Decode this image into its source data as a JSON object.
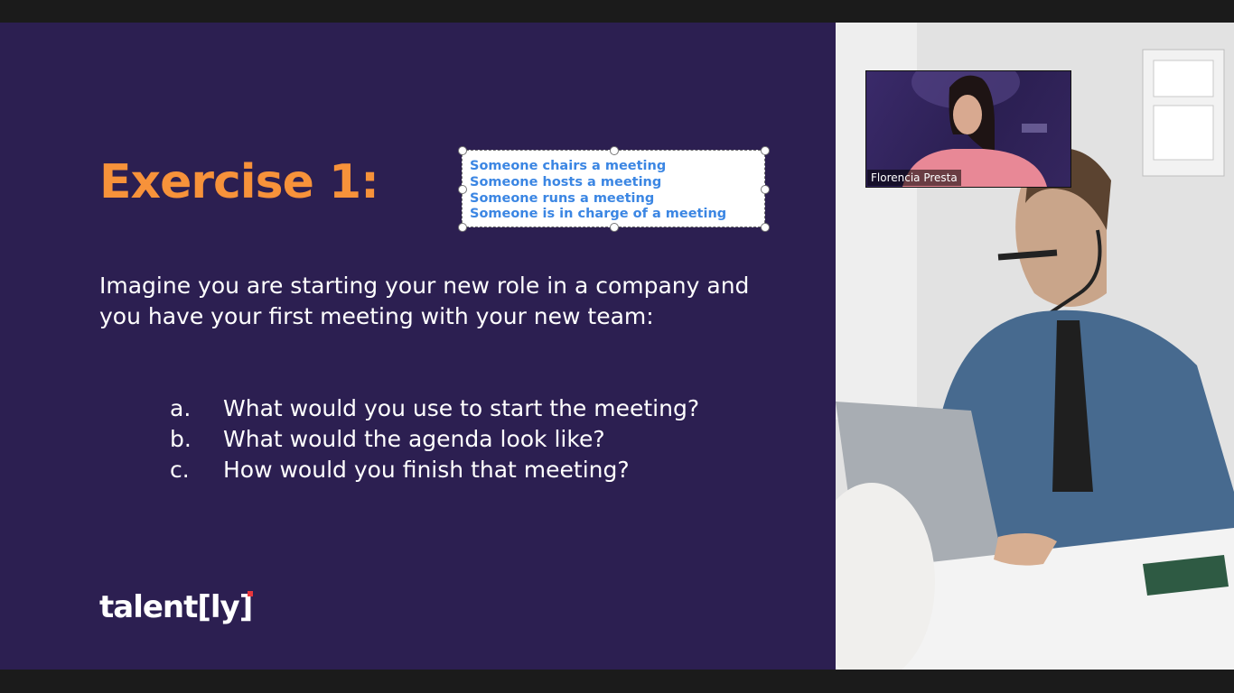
{
  "slide": {
    "title": "Exercise 1:",
    "textbox_lines": [
      "Someone chairs a meeting",
      "Someone hosts a meeting",
      "Someone runs a meeting",
      "Someone is in charge of a meeting"
    ],
    "body": "Imagine you are starting your new role in a company and you have your first meeting with your new team:",
    "questions": [
      {
        "letter": "a.",
        "text": "What would you use to start the meeting?"
      },
      {
        "letter": "b.",
        "text": "What would the agenda look like?"
      },
      {
        "letter": "c.",
        "text": "How would you finish that meeting?"
      }
    ],
    "logo": "talent[ly]"
  },
  "video": {
    "participant_name": "Florencia Presta"
  },
  "colors": {
    "slide_bg": "#2c1f51",
    "title": "#f7923a",
    "textbox_text": "#3b86e3",
    "logo_accent": "#e8363c"
  }
}
